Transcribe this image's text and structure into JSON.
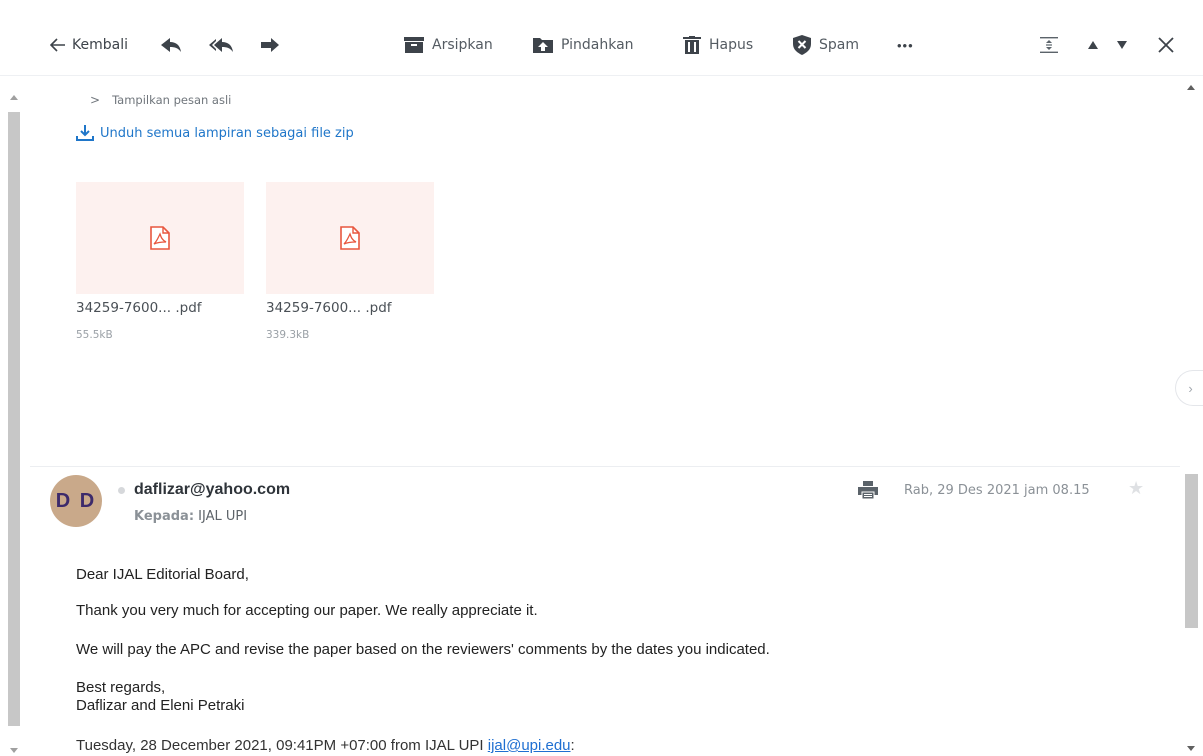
{
  "toolbar": {
    "back_label": "Kembali",
    "archive_label": "Arsipkan",
    "move_label": "Pindahkan",
    "delete_label": "Hapus",
    "spam_label": "Spam",
    "more_label": "•••"
  },
  "thread": {
    "show_original": "Tampilkan pesan asli",
    "download_all": "Unduh semua lampiran sebagai file zip",
    "attachments": [
      {
        "name": "34259-7600... .pdf",
        "size": "55.5kB",
        "icon": "pdf-icon"
      },
      {
        "name": "34259-7600... .pdf",
        "size": "339.3kB",
        "icon": "pdf-icon"
      }
    ]
  },
  "message": {
    "avatar_initials": "D D",
    "sender": "daflizar@yahoo.com",
    "to_label": "Kepada:",
    "recipient": "IJAL UPI",
    "date": "Rab, 29 Des 2021 jam 08.15",
    "body": {
      "greeting": "Dear IJAL Editorial Board,",
      "line1": "Thank you very much for accepting our paper. We really appreciate it.",
      "line2": "We will pay the APC and revise the paper based on the reviewers' comments by the dates you indicated.",
      "closing1": "Best regards,",
      "closing2": "Daflizar and Eleni Petraki",
      "quote_prefix": "Tuesday, 28 December 2021, 09:41PM +07:00 from IJAL UPI",
      "quote_email": "ijal@upi.edu",
      "quote_suffix": ":"
    }
  },
  "colors": {
    "accent_link": "#1f76c9",
    "attachment_bg": "#fdf1ef",
    "pdf_icon": "#e8573f"
  }
}
